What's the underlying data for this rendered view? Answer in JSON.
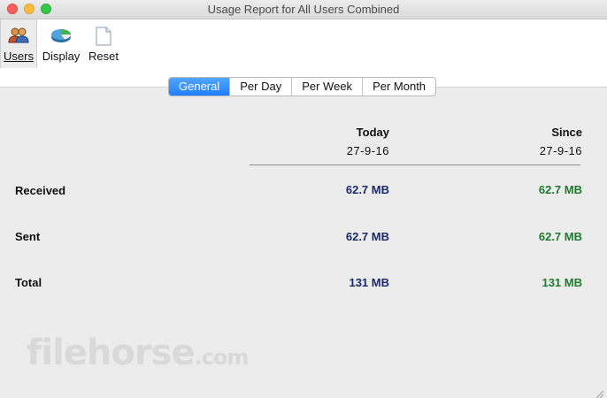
{
  "window": {
    "title": "Usage Report for All Users Combined"
  },
  "toolbar": {
    "users_label": "Users",
    "display_label": "Display",
    "reset_label": "Reset"
  },
  "tabs": [
    {
      "label": "General",
      "active": true
    },
    {
      "label": "Per Day",
      "active": false
    },
    {
      "label": "Per Week",
      "active": false
    },
    {
      "label": "Per Month",
      "active": false
    }
  ],
  "columns": {
    "today": {
      "header": "Today",
      "date": "27-9-16"
    },
    "since": {
      "header": "Since",
      "date": "27-9-16"
    }
  },
  "rows": [
    {
      "label": "Received",
      "today": "62.7 MB",
      "since": "62.7 MB"
    },
    {
      "label": "Sent",
      "today": "62.7 MB",
      "since": "62.7 MB"
    },
    {
      "label": "Total",
      "today": "131 MB",
      "since": "131 MB"
    }
  ],
  "colors": {
    "today_value": "#1c2a6b",
    "since_value": "#1e7a2e",
    "accent": "#1f7eff"
  },
  "watermark": {
    "text": "filehorse",
    "suffix": ".com"
  }
}
